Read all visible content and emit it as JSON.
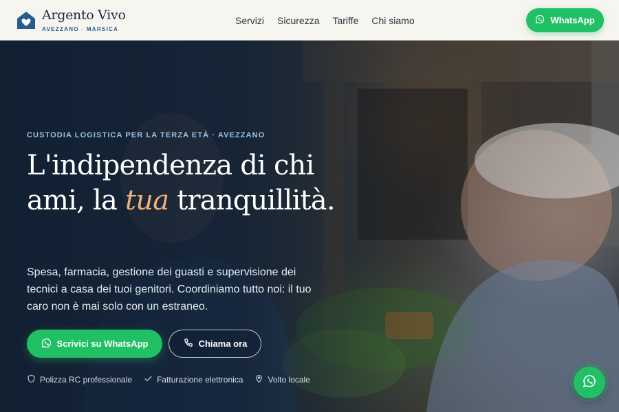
{
  "brand": {
    "name": "Argento Vivo",
    "subtitle": "AVEZZANO · MARSICA"
  },
  "nav": {
    "items": [
      "Servizi",
      "Sicurezza",
      "Tariffe",
      "Chi siamo"
    ]
  },
  "header_cta": {
    "label": "WhatsApp"
  },
  "hero": {
    "eyebrow": "CUSTODIA LOGISTICA PER LA TERZA ETÀ · AVEZZANO",
    "headline_part1": "L'indipendenza di chi ami, la ",
    "headline_accent": "tua",
    "headline_part2": " tranquillità.",
    "lead": "Spesa, farmacia, gestione dei guasti e supervisione dei tecnici a casa dei tuoi genitori. Coordiniamo tutto noi: il tuo caro non è mai solo con un estraneo.",
    "primary_cta": "Scrivici su WhatsApp",
    "secondary_cta": "Chiama ora",
    "trust": [
      {
        "icon": "shield-icon",
        "label": "Polizza RC professionale"
      },
      {
        "icon": "check-icon",
        "label": "Fatturazione elettronica"
      },
      {
        "icon": "map-pin-icon",
        "label": "Volto locale"
      }
    ]
  },
  "colors": {
    "whatsapp_green": "#22c065",
    "brand_blue": "#2a5a92",
    "accent_peach": "#f0b07a",
    "header_bg": "#f6f5f0"
  }
}
